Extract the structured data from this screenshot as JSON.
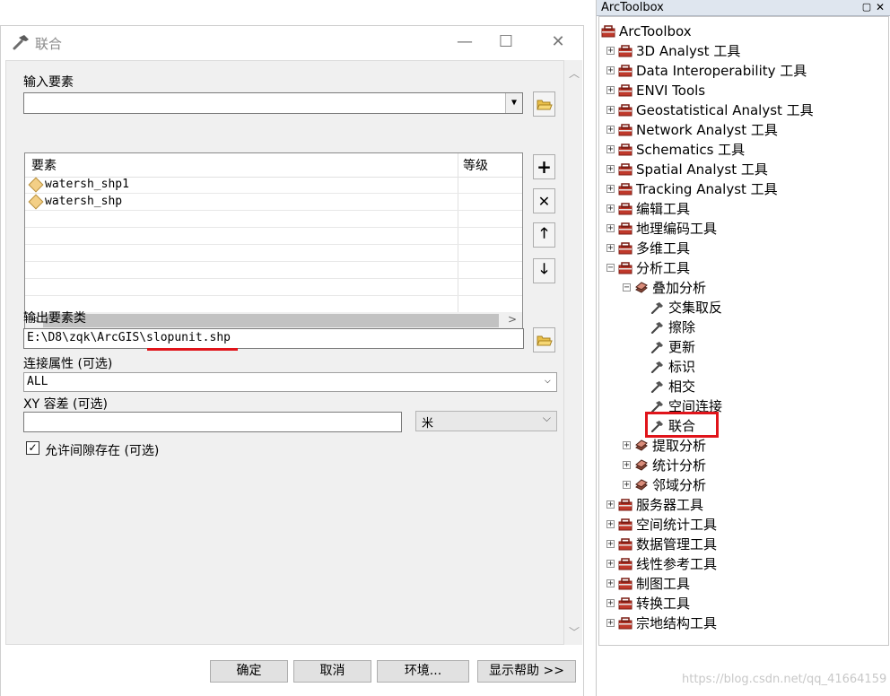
{
  "dialog": {
    "title": "联合",
    "window_buttons": {
      "minimize": "—",
      "maximize": "☐",
      "close": "✕"
    },
    "input_features_label": "输入要素",
    "input_features_value": "",
    "table": {
      "col_features": "要素",
      "col_rank": "等级",
      "rows": [
        {
          "feature": "watersh_shp1",
          "rank": ""
        },
        {
          "feature": "watersh_shp",
          "rank": ""
        }
      ]
    },
    "output_label": "输出要素类",
    "output_value": "E:\\D8\\zqk\\ArcGIS\\slopunit.shp",
    "join_attr_label": "连接属性 (可选)",
    "join_attr_value": "ALL",
    "xy_label": "XY 容差 (可选)",
    "xy_value": "",
    "xy_unit": "米",
    "gaps_label": "允许间隙存在 (可选)",
    "gaps_checked": true,
    "buttons": {
      "ok": "确定",
      "cancel": "取消",
      "env": "环境...",
      "help": "显示帮助 >>"
    }
  },
  "toolbox": {
    "title": "ArcToolbox",
    "root": "ArcToolbox",
    "items": [
      {
        "label": "3D Analyst 工具",
        "expander": "+"
      },
      {
        "label": "Data Interoperability 工具",
        "expander": "+"
      },
      {
        "label": "ENVI Tools",
        "expander": "+"
      },
      {
        "label": "Geostatistical Analyst 工具",
        "expander": "+"
      },
      {
        "label": "Network Analyst 工具",
        "expander": "+"
      },
      {
        "label": "Schematics 工具",
        "expander": "+"
      },
      {
        "label": "Spatial Analyst 工具",
        "expander": "+"
      },
      {
        "label": "Tracking Analyst 工具",
        "expander": "+"
      },
      {
        "label": "编辑工具",
        "expander": "+"
      },
      {
        "label": "地理编码工具",
        "expander": "+"
      },
      {
        "label": "多维工具",
        "expander": "+"
      },
      {
        "label": "分析工具",
        "expander": "−"
      }
    ],
    "analysis_sub": [
      {
        "label": "叠加分析",
        "expander": "−"
      }
    ],
    "overlay_tools": [
      "交集取反",
      "擦除",
      "更新",
      "标识",
      "相交",
      "空间连接",
      "联合"
    ],
    "analysis_sub_after": [
      {
        "label": "提取分析",
        "expander": "+"
      },
      {
        "label": "统计分析",
        "expander": "+"
      },
      {
        "label": "邻域分析",
        "expander": "+"
      }
    ],
    "items_after": [
      {
        "label": "服务器工具",
        "expander": "+"
      },
      {
        "label": "空间统计工具",
        "expander": "+"
      },
      {
        "label": "数据管理工具",
        "expander": "+"
      },
      {
        "label": "线性参考工具",
        "expander": "+"
      },
      {
        "label": "制图工具",
        "expander": "+"
      },
      {
        "label": "转换工具",
        "expander": "+"
      },
      {
        "label": "宗地结构工具",
        "expander": "+"
      }
    ]
  },
  "watermark": "https://blog.csdn.net/qq_41664159",
  "colors": {
    "highlight": "#e0141a",
    "toolbox_icon": "#c0392b"
  }
}
